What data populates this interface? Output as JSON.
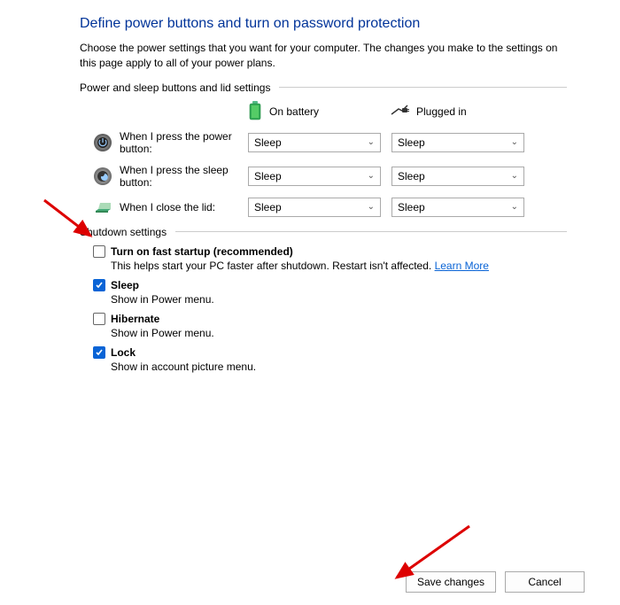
{
  "title": "Define power buttons and turn on password protection",
  "description": "Choose the power settings that you want for your computer. The changes you make to the settings on this page apply to all of your power plans.",
  "section1": {
    "header": "Power and sleep buttons and lid settings",
    "col_battery": "On battery",
    "col_plugged": "Plugged in",
    "rows": [
      {
        "label": "When I press the power button:",
        "battery": "Sleep",
        "plugged": "Sleep"
      },
      {
        "label": "When I press the sleep button:",
        "battery": "Sleep",
        "plugged": "Sleep"
      },
      {
        "label": "When I close the lid:",
        "battery": "Sleep",
        "plugged": "Sleep"
      }
    ]
  },
  "section2": {
    "header": "Shutdown settings",
    "items": [
      {
        "checked": false,
        "label": "Turn on fast startup (recommended)",
        "sub": "This helps start your PC faster after shutdown. Restart isn't affected. ",
        "link": "Learn More"
      },
      {
        "checked": true,
        "label": "Sleep",
        "sub": "Show in Power menu."
      },
      {
        "checked": false,
        "label": "Hibernate",
        "sub": "Show in Power menu."
      },
      {
        "checked": true,
        "label": "Lock",
        "sub": "Show in account picture menu."
      }
    ]
  },
  "buttons": {
    "save": "Save changes",
    "cancel": "Cancel"
  }
}
